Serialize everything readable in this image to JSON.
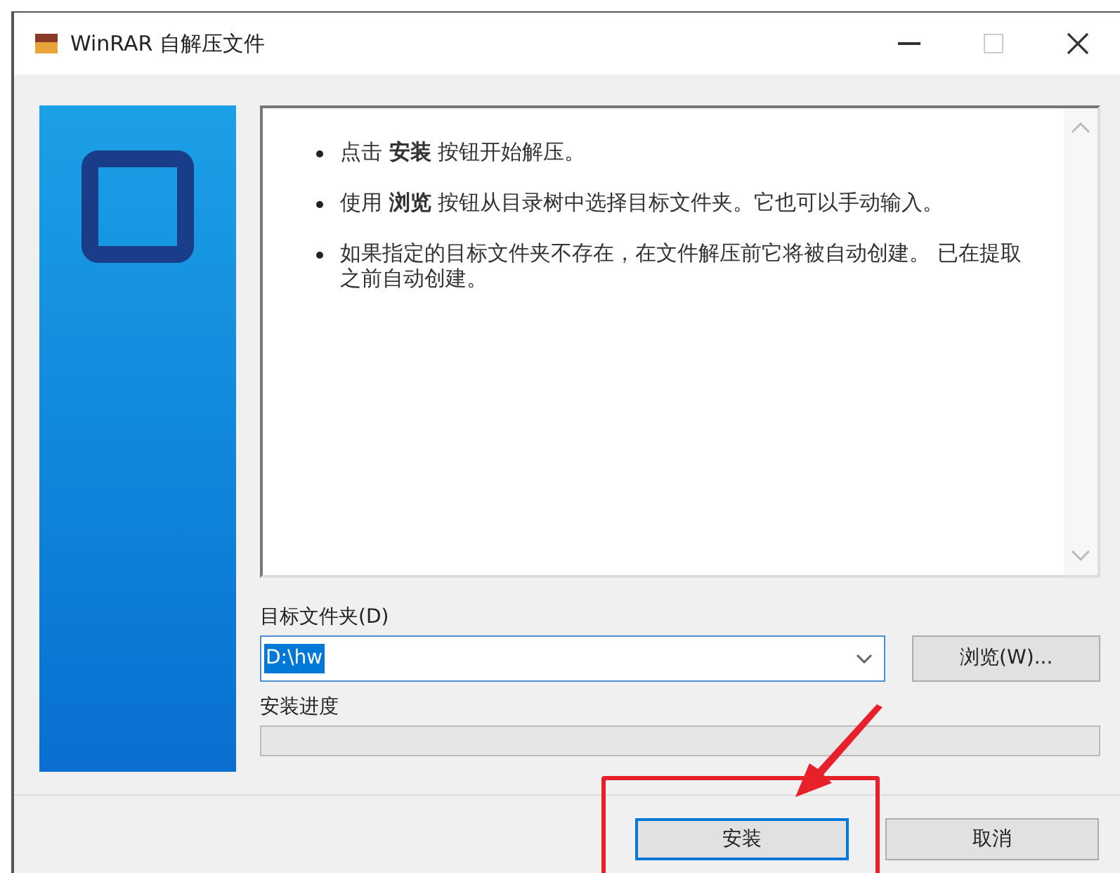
{
  "window": {
    "title": "WinRAR 自解压文件"
  },
  "instructions": [
    {
      "text": "点击 **安装** 按钮开始解压。"
    },
    {
      "text": "使用 **浏览** 按钮从目录树中选择目标文件夹。它也可以手动输入。"
    },
    {
      "text": "如果指定的目标文件夹不存在，在文件解压前它将被自动创建。 已在提取之前自动创建。"
    }
  ],
  "destination": {
    "label": "目标文件夹(D)",
    "value": "D:\\hw",
    "browse_button": "浏览(W)..."
  },
  "progress": {
    "label": "安装进度"
  },
  "buttons": [
    {
      "label": "安装",
      "default": true,
      "highlighted": true
    },
    {
      "label": "取消",
      "default": false,
      "highlighted": false
    }
  ]
}
